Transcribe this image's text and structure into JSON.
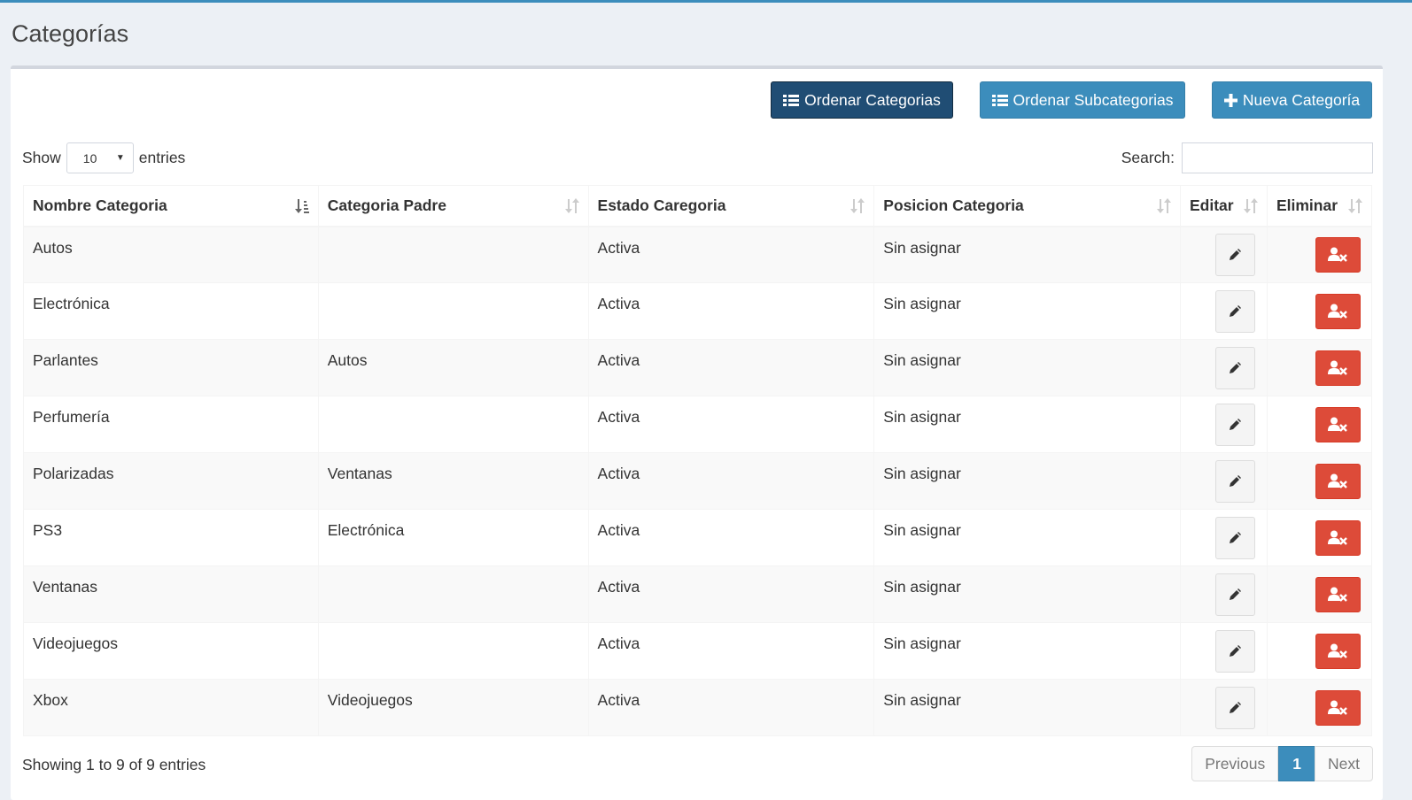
{
  "page": {
    "title": "Categorías"
  },
  "toolbar": {
    "order_categories": "Ordenar Categorias",
    "order_subcategories": "Ordenar Subcategorias",
    "new_category": "Nueva Categoría"
  },
  "controls": {
    "show_label": "Show",
    "entries_label": "entries",
    "page_size": "10",
    "search_label": "Search:",
    "search_value": ""
  },
  "table": {
    "columns": [
      "Nombre Categoria",
      "Categoria Padre",
      "Estado Caregoria",
      "Posicion Categoria",
      "Editar",
      "Eliminar"
    ],
    "rows": [
      [
        "Autos",
        "",
        "Activa",
        "Sin asignar"
      ],
      [
        "Electrónica",
        "",
        "Activa",
        "Sin asignar"
      ],
      [
        "Parlantes",
        "Autos",
        "Activa",
        "Sin asignar"
      ],
      [
        "Perfumería",
        "",
        "Activa",
        "Sin asignar"
      ],
      [
        "Polarizadas",
        "Ventanas",
        "Activa",
        "Sin asignar"
      ],
      [
        "PS3",
        "Electrónica",
        "Activa",
        "Sin asignar"
      ],
      [
        "Ventanas",
        "",
        "Activa",
        "Sin asignar"
      ],
      [
        "Videojuegos",
        "",
        "Activa",
        "Sin asignar"
      ],
      [
        "Xbox",
        "Videojuegos",
        "Activa",
        "Sin asignar"
      ]
    ]
  },
  "footer": {
    "info": "Showing 1 to 9 of 9 entries",
    "previous": "Previous",
    "current_page": "1",
    "next": "Next"
  },
  "colors": {
    "accent": "#3c8dbc",
    "dark_button": "#204d74",
    "danger": "#dd4b39"
  },
  "icons": {
    "toolbar_list": "list-icon",
    "toolbar_new": "plus-icon",
    "edit": "pencil-icon",
    "delete": "user-times-icon"
  }
}
